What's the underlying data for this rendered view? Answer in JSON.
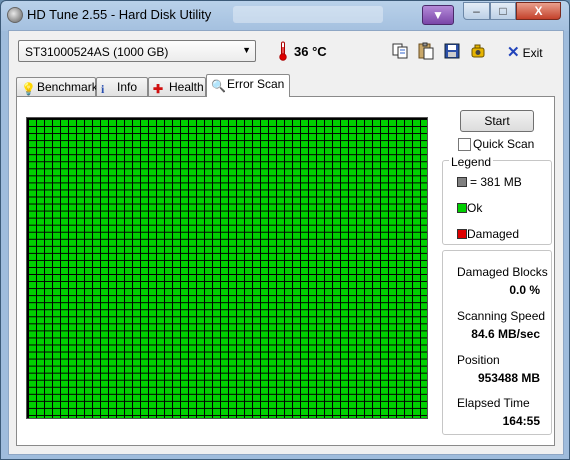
{
  "window": {
    "title": "HD Tune 2.55 - Hard Disk Utility",
    "controls": {
      "minimize": "–",
      "maximize": "□",
      "close": "X"
    }
  },
  "toolbar": {
    "drive": "ST31000524AS (1000 GB)",
    "temperature": "36 °C",
    "exit_label": "Exit"
  },
  "tabs": [
    {
      "label": "Benchmark",
      "icon": "benchmark-icon"
    },
    {
      "label": "Info",
      "icon": "info-icon"
    },
    {
      "label": "Health",
      "icon": "health-cross-icon"
    },
    {
      "label": "Error Scan",
      "icon": "magnifier-icon",
      "active": true
    }
  ],
  "scan": {
    "start_label": "Start",
    "quick_scan_label": "Quick Scan",
    "quick_scan_checked": false,
    "legend": {
      "title": "Legend",
      "block_size": "= 381 MB",
      "ok": "Ok",
      "damaged": "Damaged"
    },
    "colors": {
      "ok": "#00d000",
      "damaged": "#dd0000",
      "block": "#808080"
    },
    "stats": {
      "damaged_blocks_label": "Damaged Blocks",
      "damaged_blocks_value": "0.0 %",
      "speed_label": "Scanning Speed",
      "speed_value": "84.6 MB/sec",
      "position_label": "Position",
      "position_value": "953488 MB",
      "elapsed_label": "Elapsed Time",
      "elapsed_value": "164:55"
    }
  }
}
